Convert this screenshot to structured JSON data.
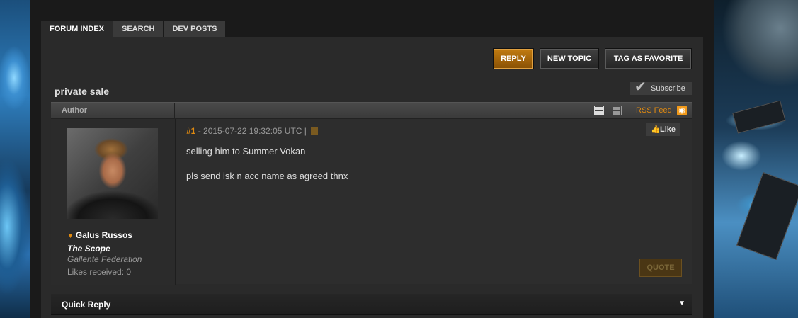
{
  "tabs": [
    {
      "label": "FORUM INDEX"
    },
    {
      "label": "SEARCH"
    },
    {
      "label": "DEV POSTS"
    }
  ],
  "actions": {
    "reply": "REPLY",
    "new_topic": "NEW TOPIC",
    "tag_favorite": "TAG AS FAVORITE"
  },
  "thread": {
    "title": "private sale",
    "subscribe_label": "Subscribe",
    "author_header": "Author",
    "rss_label": "RSS Feed"
  },
  "post": {
    "number": "#1",
    "meta": " - 2015-07-22 19:32:05 UTC  |",
    "like_label": "Like",
    "lines": [
      "selling him to Summer Vokan",
      "pls send isk n acc name as agreed thnx"
    ],
    "quote_label": "QUOTE",
    "author": {
      "name": "Galus Russos",
      "corporation": "The Scope",
      "faction": "Gallente Federation",
      "likes_received": "Likes received: 0"
    }
  },
  "quick_reply": {
    "label": "Quick Reply"
  },
  "colors": {
    "accent": "#e08a10",
    "reply_button": "#c07a10",
    "panel": "#2a2a2a"
  },
  "icons": [
    "subscribe-check-icon",
    "layout-threaded-icon",
    "layout-flat-icon",
    "rss-icon",
    "flag-icon",
    "thumbs-up-icon",
    "caret-down-icon",
    "expand-arrow-icon"
  ]
}
